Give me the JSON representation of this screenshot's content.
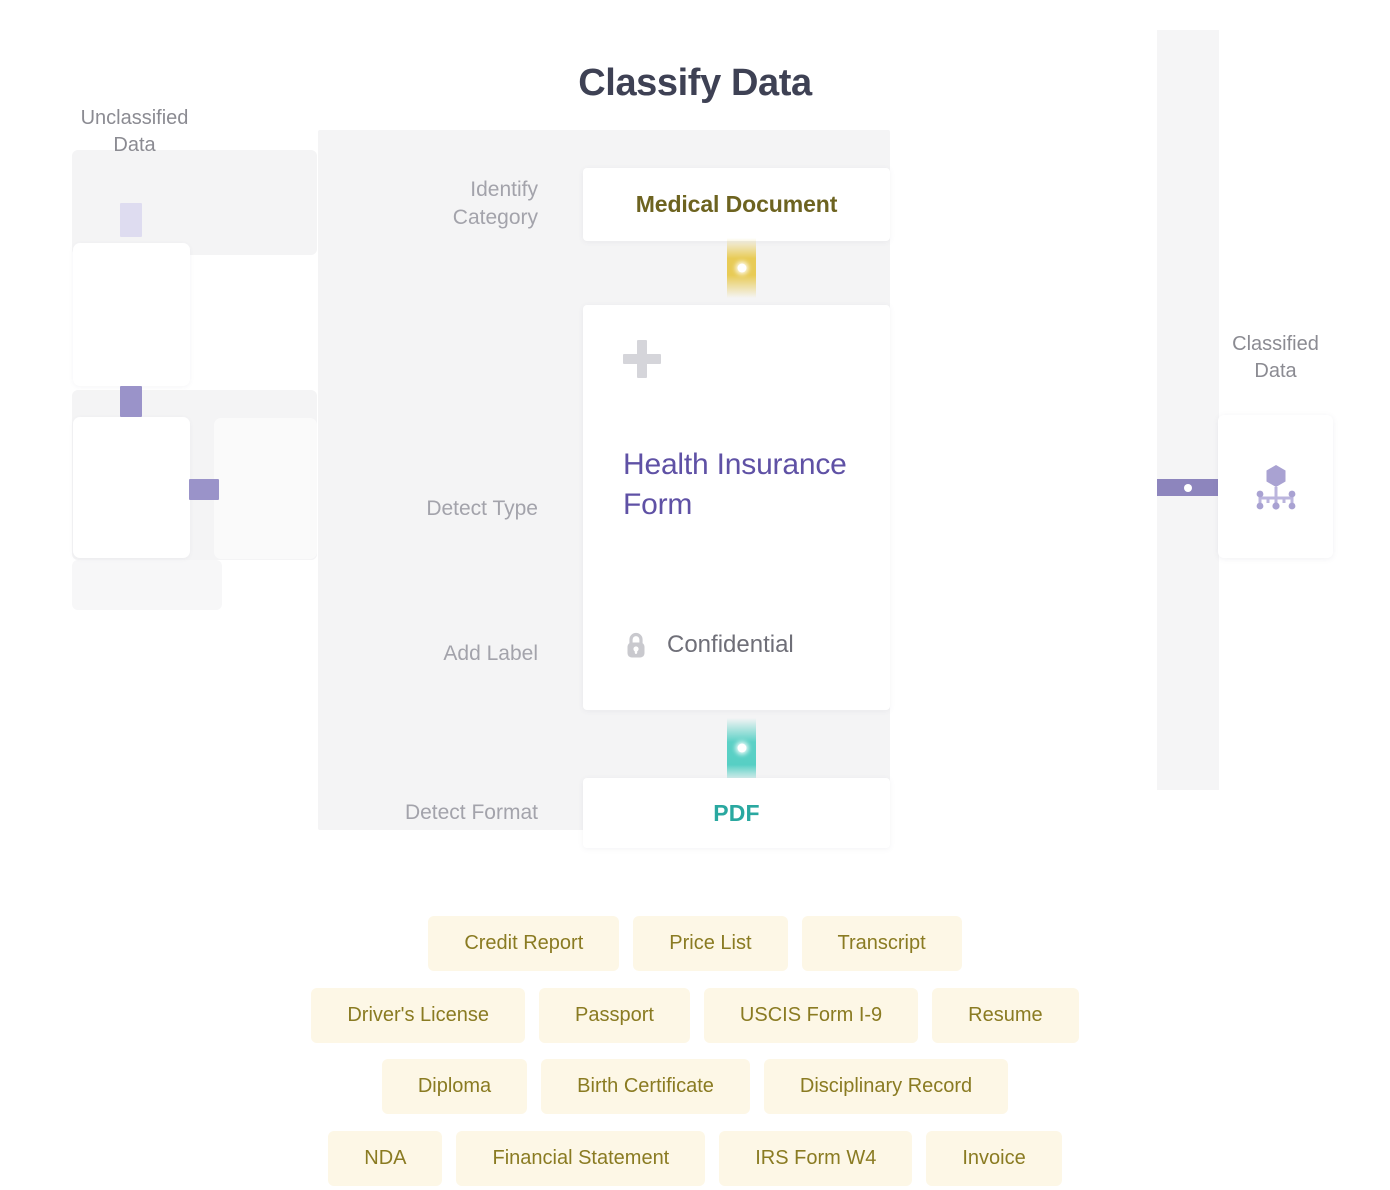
{
  "header": {
    "title": "Classify Data"
  },
  "left_panel": {
    "caption": "Unclassified\nData",
    "caption_line1": "Unclassified",
    "caption_line2": "Data"
  },
  "right_panel": {
    "caption_line1": "Classified",
    "caption_line2": "Data",
    "icon": "network-node-icon"
  },
  "steps": {
    "identify_category": {
      "label": "Identify\nCategory",
      "label_line1": "Identify",
      "label_line2": "Category",
      "value": "Medical Document"
    },
    "detect_type": {
      "label": "Detect Type",
      "value": "Health Insurance Form",
      "add_icon": "plus-icon"
    },
    "add_label": {
      "label": "Add Label",
      "value": "Confidential",
      "icon": "lock-icon"
    },
    "detect_format": {
      "label": "Detect Format",
      "value": "PDF"
    }
  },
  "tag_rows": [
    [
      "Credit Report",
      "Price List",
      "Transcript"
    ],
    [
      "Driver's License",
      "Passport",
      "USCIS Form I-9",
      "Resume"
    ],
    [
      "Diploma",
      "Birth Certificate",
      "Disciplinary Record"
    ],
    [
      "NDA",
      "Financial Statement",
      "IRS Form W4",
      "Invoice"
    ]
  ],
  "colors": {
    "title": "#3e4154",
    "category_text": "#6d6320",
    "doctype_text": "#5f51a5",
    "format_text": "#2aa8a0",
    "tag_bg": "#fdf7e6",
    "tag_text": "#8a7b22",
    "connector_yellow": "#e8cb56",
    "connector_teal": "#57cfc4",
    "connector_purple": "#8d85bd",
    "muted_label": "#a3a3ab"
  }
}
